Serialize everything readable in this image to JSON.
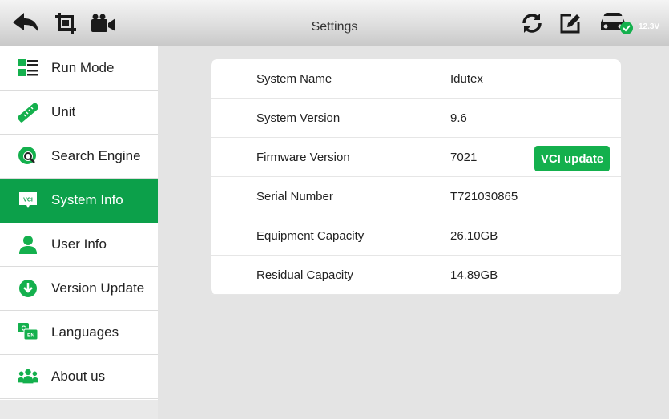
{
  "header": {
    "title": "Settings",
    "voltage": "12.3V",
    "accent": "#0ca04a",
    "icons": [
      "back-arrow-icon",
      "crop-icon",
      "video-camera-icon",
      "refresh-icon",
      "edit-icon",
      "vehicle-connected-icon"
    ]
  },
  "sidebar": {
    "active_index": 3,
    "items": [
      {
        "label": "Run Mode",
        "icon": "run-mode-icon"
      },
      {
        "label": "Unit",
        "icon": "ruler-icon"
      },
      {
        "label": "Search Engine",
        "icon": "search-engine-icon"
      },
      {
        "label": "System Info",
        "icon": "vci-icon"
      },
      {
        "label": "User Info",
        "icon": "user-icon"
      },
      {
        "label": "Version Update",
        "icon": "download-icon"
      },
      {
        "label": "Languages",
        "icon": "languages-icon"
      },
      {
        "label": "About us",
        "icon": "group-icon"
      }
    ]
  },
  "system_info": {
    "rows": [
      {
        "label": "System Name",
        "value": "Idutex"
      },
      {
        "label": "System Version",
        "value": "9.6"
      },
      {
        "label": "Firmware Version",
        "value": "7021"
      },
      {
        "label": "Serial Number",
        "value": "T721030865"
      },
      {
        "label": "Equipment Capacity",
        "value": "26.10GB"
      },
      {
        "label": "Residual Capacity",
        "value": "14.89GB"
      }
    ],
    "vci_update_label": "VCI update"
  }
}
